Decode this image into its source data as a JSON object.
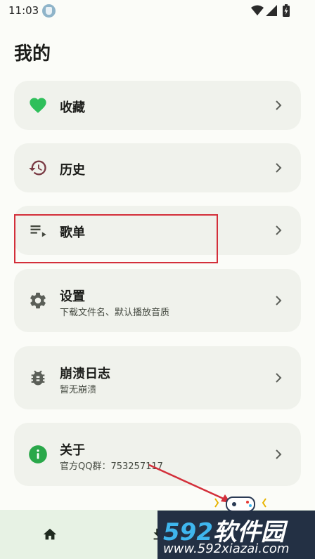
{
  "status_bar": {
    "time": "11:03"
  },
  "page": {
    "title": "我的"
  },
  "menu": {
    "favorites": {
      "title": "收藏"
    },
    "history": {
      "title": "历史"
    },
    "playlist": {
      "title": "歌单"
    },
    "settings": {
      "title": "设置",
      "subtitle": "下载文件名、默认播放音质"
    },
    "crash_log": {
      "title": "崩溃日志",
      "subtitle": "暂无崩溃"
    },
    "about": {
      "title": "关于",
      "subtitle": "官方QQ群：753257117"
    }
  },
  "watermark": {
    "logo_number": "592",
    "logo_text": "软件园",
    "url": "www.592xiazai.com"
  },
  "colors": {
    "favorite_heart": "#2fbf5b",
    "history_icon": "#7a3b44",
    "about_icon": "#2aa84a",
    "card_bg": "#f0f2ec",
    "highlight_border": "#d32f3a",
    "bottom_nav_bg": "#e7f2e4"
  },
  "icons": {
    "favorites": "heart-icon",
    "history": "history-icon",
    "playlist": "playlist-icon",
    "settings": "gear-icon",
    "crash_log": "bug-icon",
    "about": "info-icon",
    "nav_home": "home-icon",
    "nav_download": "download-icon"
  }
}
